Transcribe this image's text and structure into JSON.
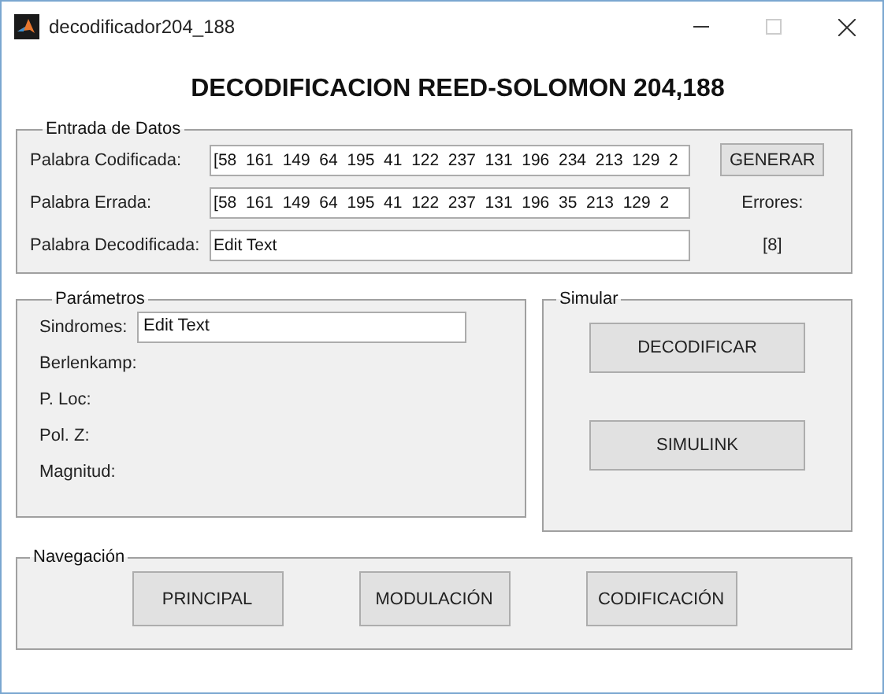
{
  "window": {
    "title": "decodificador204_188"
  },
  "heading": "DECODIFICACION REED-SOLOMON 204,188",
  "entrada": {
    "title": "Entrada de Datos",
    "rows": [
      {
        "label": "Palabra Codificada:",
        "value": "[58  161  149  64  195  41  122  237  131  196  234  213  129  2"
      },
      {
        "label": "Palabra Errada:",
        "value": "[58  161  149  64  195  41  122  237  131  196  35  213  129  2"
      },
      {
        "label": "Palabra Decodificada:",
        "value": "Edit Text"
      }
    ],
    "button": "GENERAR",
    "errors_label": "Errores:",
    "errors_value": "[8]"
  },
  "parametros": {
    "title": "Parámetros",
    "rows": [
      {
        "kind": "field",
        "label": "Sindromes:",
        "value": "Edit Text"
      },
      {
        "kind": "label",
        "label": "Berlenkamp:"
      },
      {
        "kind": "label",
        "label": "P. Loc:"
      },
      {
        "kind": "label",
        "label": "Pol. Z:"
      },
      {
        "kind": "label",
        "label": "Magnitud:"
      }
    ]
  },
  "simular": {
    "title": "Simular",
    "buttons": [
      "DECODIFICAR",
      "SIMULINK"
    ]
  },
  "navegacion": {
    "title": "Navegación",
    "buttons": [
      "PRINCIPAL",
      "MODULACIÓN",
      "CODIFICACIÓN"
    ]
  }
}
